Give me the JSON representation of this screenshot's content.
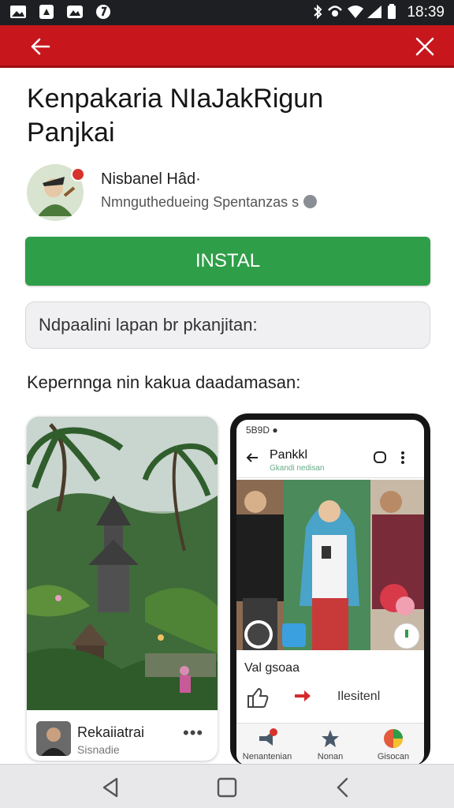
{
  "status_bar": {
    "time": "18:39",
    "left_icons": [
      "image-icon",
      "alert-icon",
      "gallery-icon",
      "sync-icon"
    ],
    "right_icons": [
      "bluetooth-icon",
      "location-icon",
      "wifi-icon",
      "signal-icon",
      "battery-icon"
    ]
  },
  "app_bar": {
    "color": "#c8161d",
    "back_icon": "back-arrow-icon",
    "close_icon": "close-icon"
  },
  "app": {
    "title_line1": "Kenpakaria NIaJakRigun",
    "title_line2": "Panjkai",
    "developer": "Nisbanel‌ Hâd·",
    "developer_sub": "Nmnguthedueing Spentanzas s",
    "install_label": "INSTAL",
    "install_color": "#2f9e48",
    "note": "Ndpaalini lapan br pkanjitan:"
  },
  "screenshots_section": {
    "heading": "Kepernnga nin kakua daadamasan:",
    "card1": {
      "title": "Rekaiiatrai",
      "subtitle": "Sisnadie",
      "more": "•••"
    },
    "phone": {
      "status": "5B9D ●",
      "title": "Pankkl",
      "subtitle": "Gkandi nedisan",
      "caption": "Val gsoaa",
      "action_label": "Ilesitenl",
      "nav": [
        {
          "label": "Nenantenian",
          "icon": "megaphone-icon"
        },
        {
          "label": "Nonan",
          "icon": "star-icon"
        },
        {
          "label": "Gisocan",
          "icon": "palette-icon"
        }
      ]
    }
  },
  "nav_bar": {
    "icons": [
      "back-triangle-icon",
      "home-square-icon",
      "recents-chevron-icon"
    ]
  }
}
